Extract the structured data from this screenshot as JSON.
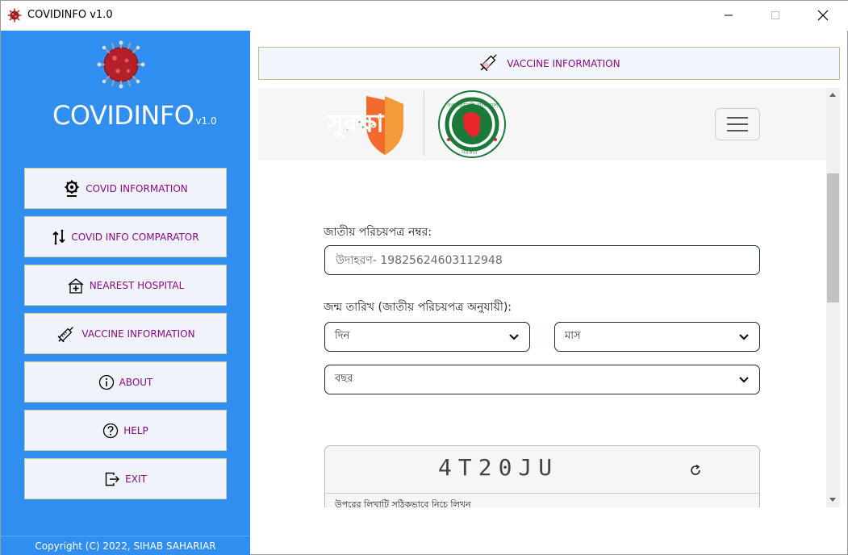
{
  "window": {
    "title": "COVIDINFO v1.0",
    "icon": "virus-icon",
    "controls": [
      "minimize",
      "maximize",
      "close"
    ]
  },
  "sidebar": {
    "brand": "COVIDINFO",
    "version": "v1.0",
    "bg_color": "#2f8ef0",
    "label_color": "#8a0a8a",
    "items": [
      {
        "label": "COVID INFORMATION",
        "icon": "covid-gear-icon"
      },
      {
        "label": "COVID INFO COMPARATOR",
        "icon": "compare-arrows-icon"
      },
      {
        "label": "NEAREST HOSPITAL",
        "icon": "hospital-icon"
      },
      {
        "label": "VACCINE INFORMATION",
        "icon": "syringe-icon"
      },
      {
        "label": "ABOUT",
        "icon": "info-icon"
      },
      {
        "label": "HELP",
        "icon": "help-icon"
      },
      {
        "label": "EXIT",
        "icon": "exit-icon"
      }
    ],
    "footer": "Copyright (C) 2022, SIHAB SAHARIAR"
  },
  "header": {
    "label": "VACCINE INFORMATION",
    "icon": "syringe-icon"
  },
  "webview": {
    "site_logo_text": "সুরক্ষা",
    "gov_seal_top": "গণপ্রজাতন্ত্রী বাংলাদেশ",
    "gov_seal_bottom": "সরকার",
    "nid_label": "জাতীয় পরিচয়পত্র নম্বর:",
    "nid_placeholder": "উদাহরণ- 19825624603112948",
    "dob_label": "জন্ম তারিখ (জাতীয় পরিচয়পত্র অনুযায়ী):",
    "day_select": "দিন",
    "month_select": "মাস",
    "year_select": "বছর",
    "captcha_code": "4T20JU",
    "captcha_hint": "উপরের লিখাটি সঠিকভাবে নিচে লিখুন"
  }
}
